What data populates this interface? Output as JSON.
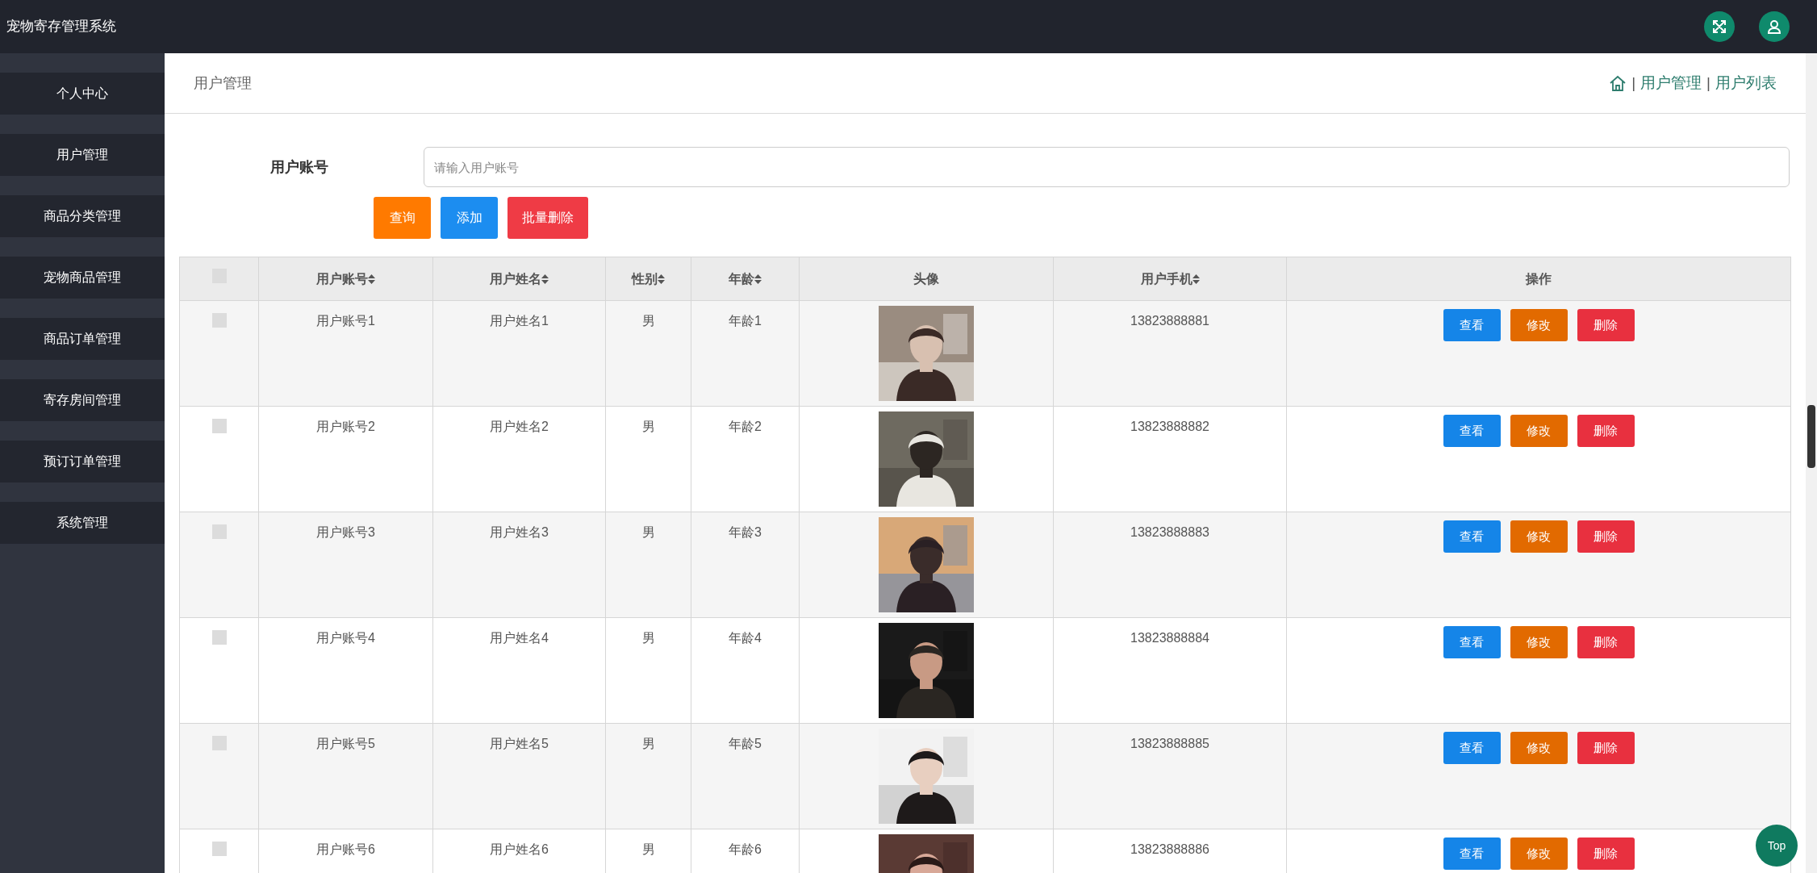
{
  "app_title": "宠物寄存管理系统",
  "sidebar": {
    "items": [
      {
        "label": "个人中心",
        "selected": false
      },
      {
        "label": "用户管理",
        "selected": false
      },
      {
        "label": "商品分类管理",
        "selected": false
      },
      {
        "label": "宠物商品管理",
        "selected": false
      },
      {
        "label": "商品订单管理",
        "selected": false
      },
      {
        "label": "寄存房间管理",
        "selected": false
      },
      {
        "label": "预订订单管理",
        "selected": false
      },
      {
        "label": "系统管理",
        "selected": false
      }
    ]
  },
  "page_title": "用户管理",
  "breadcrumb": [
    {
      "kind": "separator",
      "text": "|"
    },
    {
      "kind": "link",
      "text": "用户管理"
    },
    {
      "kind": "separator",
      "text": "|"
    },
    {
      "kind": "link",
      "text": "用户列表"
    }
  ],
  "search": {
    "label": "用户账号",
    "placeholder": "请输入用户账号"
  },
  "toolbar_buttons": [
    {
      "label": "查询",
      "kind": "query"
    },
    {
      "label": "添加",
      "kind": "add"
    },
    {
      "label": "批量删除",
      "kind": "delete"
    }
  ],
  "table": {
    "columns": [
      {
        "kind": "check",
        "checked": false
      },
      {
        "label": "用户账号",
        "sortable": true
      },
      {
        "label": "用户姓名",
        "sortable": true
      },
      {
        "label": "性别",
        "sortable": true
      },
      {
        "label": "年龄",
        "sortable": true
      },
      {
        "label": "头像"
      },
      {
        "label": "用户手机",
        "sortable": true
      },
      {
        "label": "操作"
      }
    ],
    "rows": [
      {
        "checked": false,
        "account": "用户账号1",
        "name": "用户姓名1",
        "gender": "男",
        "age": "年龄1",
        "avatar": {
          "kind": "picture"
        },
        "phone": "13823888881",
        "actions": [
          {
            "label": "查看",
            "kind": "view"
          },
          {
            "label": "修改",
            "kind": "edit"
          },
          {
            "label": "删除",
            "kind": "delete"
          }
        ]
      },
      {
        "checked": false,
        "account": "用户账号2",
        "name": "用户姓名2",
        "gender": "男",
        "age": "年龄2",
        "avatar": {
          "kind": "picture"
        },
        "phone": "13823888882",
        "actions": [
          {
            "label": "查看",
            "kind": "view"
          },
          {
            "label": "修改",
            "kind": "edit"
          },
          {
            "label": "删除",
            "kind": "delete"
          }
        ]
      },
      {
        "checked": false,
        "account": "用户账号3",
        "name": "用户姓名3",
        "gender": "男",
        "age": "年龄3",
        "avatar": {
          "kind": "picture"
        },
        "phone": "13823888883",
        "actions": [
          {
            "label": "查看",
            "kind": "view"
          },
          {
            "label": "修改",
            "kind": "edit"
          },
          {
            "label": "删除",
            "kind": "delete"
          }
        ]
      },
      {
        "checked": false,
        "account": "用户账号4",
        "name": "用户姓名4",
        "gender": "男",
        "age": "年龄4",
        "avatar": {
          "kind": "picture"
        },
        "phone": "13823888884",
        "actions": [
          {
            "label": "查看",
            "kind": "view"
          },
          {
            "label": "修改",
            "kind": "edit"
          },
          {
            "label": "删除",
            "kind": "delete"
          }
        ]
      },
      {
        "checked": false,
        "account": "用户账号5",
        "name": "用户姓名5",
        "gender": "男",
        "age": "年龄5",
        "avatar": {
          "kind": "picture"
        },
        "phone": "13823888885",
        "actions": [
          {
            "label": "查看",
            "kind": "view"
          },
          {
            "label": "修改",
            "kind": "edit"
          },
          {
            "label": "删除",
            "kind": "delete"
          }
        ]
      },
      {
        "checked": false,
        "account": "用户账号6",
        "name": "用户姓名6",
        "gender": "男",
        "age": "年龄6",
        "avatar": {
          "kind": "picture"
        },
        "phone": "13823888886",
        "actions": [
          {
            "label": "查看",
            "kind": "view"
          },
          {
            "label": "修改",
            "kind": "edit"
          },
          {
            "label": "删除",
            "kind": "delete"
          }
        ]
      }
    ]
  },
  "back_to_top": "Top"
}
